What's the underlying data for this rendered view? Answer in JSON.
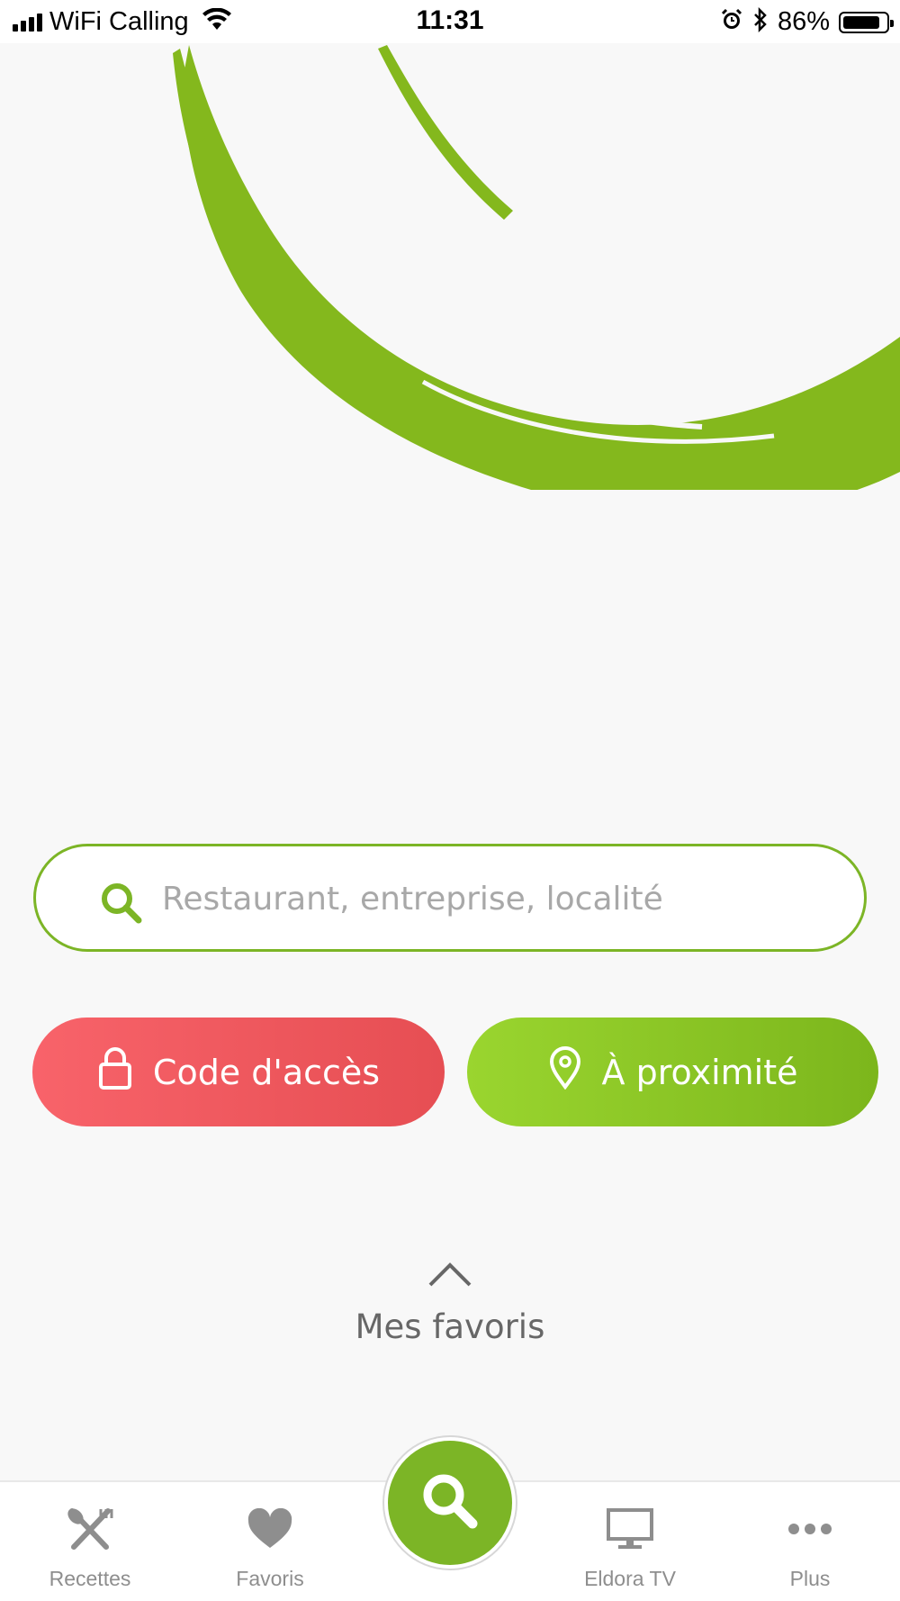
{
  "status_bar": {
    "carrier": "WiFi Calling",
    "time": "11:31",
    "battery_percent": "86%",
    "battery_level": 0.86,
    "icons": [
      "signal-icon",
      "wifi-icon",
      "alarm-icon",
      "bluetooth-icon",
      "battery-icon"
    ]
  },
  "search": {
    "placeholder": "Restaurant, entreprise, localité",
    "value": ""
  },
  "actions": {
    "access_code_label": "Code d'accès",
    "nearby_label": "À proximité"
  },
  "favorites": {
    "label": "Mes favoris"
  },
  "tabbar": {
    "items": [
      {
        "label": "Recettes",
        "icon": "utensils-icon"
      },
      {
        "label": "Favoris",
        "icon": "heart-icon"
      },
      {
        "label": "",
        "icon": "search-icon"
      },
      {
        "label": "Eldora TV",
        "icon": "monitor-icon"
      },
      {
        "label": "Plus",
        "icon": "more-dots-icon"
      }
    ]
  },
  "colors": {
    "brand_green": "#7cb526",
    "access_red": "#f15a5f",
    "text_gray": "#676767",
    "placeholder_gray": "#a8a8a8",
    "background": "#f8f8f8"
  }
}
